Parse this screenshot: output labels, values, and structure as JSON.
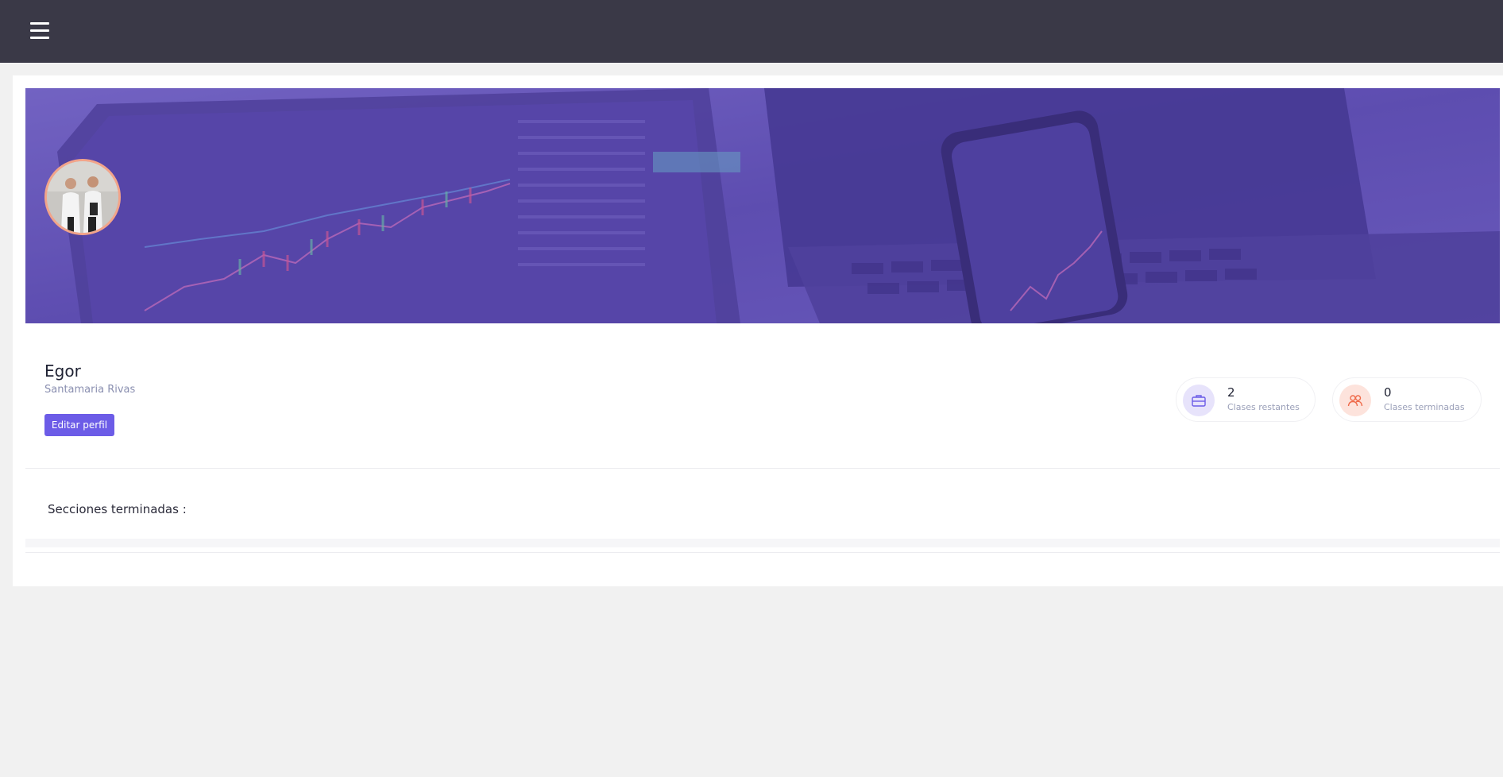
{
  "topbar": {
    "menu_icon": "hamburger-menu-icon"
  },
  "profile": {
    "first_name": "Egor",
    "last_name": "Santamaria Rivas",
    "edit_button_label": "Editar perfil"
  },
  "stats": [
    {
      "value": "2",
      "label": "Clases restantes",
      "icon": "briefcase-icon",
      "color": "#6c5ce7"
    },
    {
      "value": "0",
      "label": "Clases terminadas",
      "icon": "users-icon",
      "color": "#ef6a4a"
    }
  ],
  "sections": {
    "title": "Secciones terminadas :"
  },
  "colors": {
    "topbar": "#3a3947",
    "accent": "#6c5ce7",
    "banner_overlay": "#5b48b8",
    "avatar_border": "#f2a48a"
  }
}
